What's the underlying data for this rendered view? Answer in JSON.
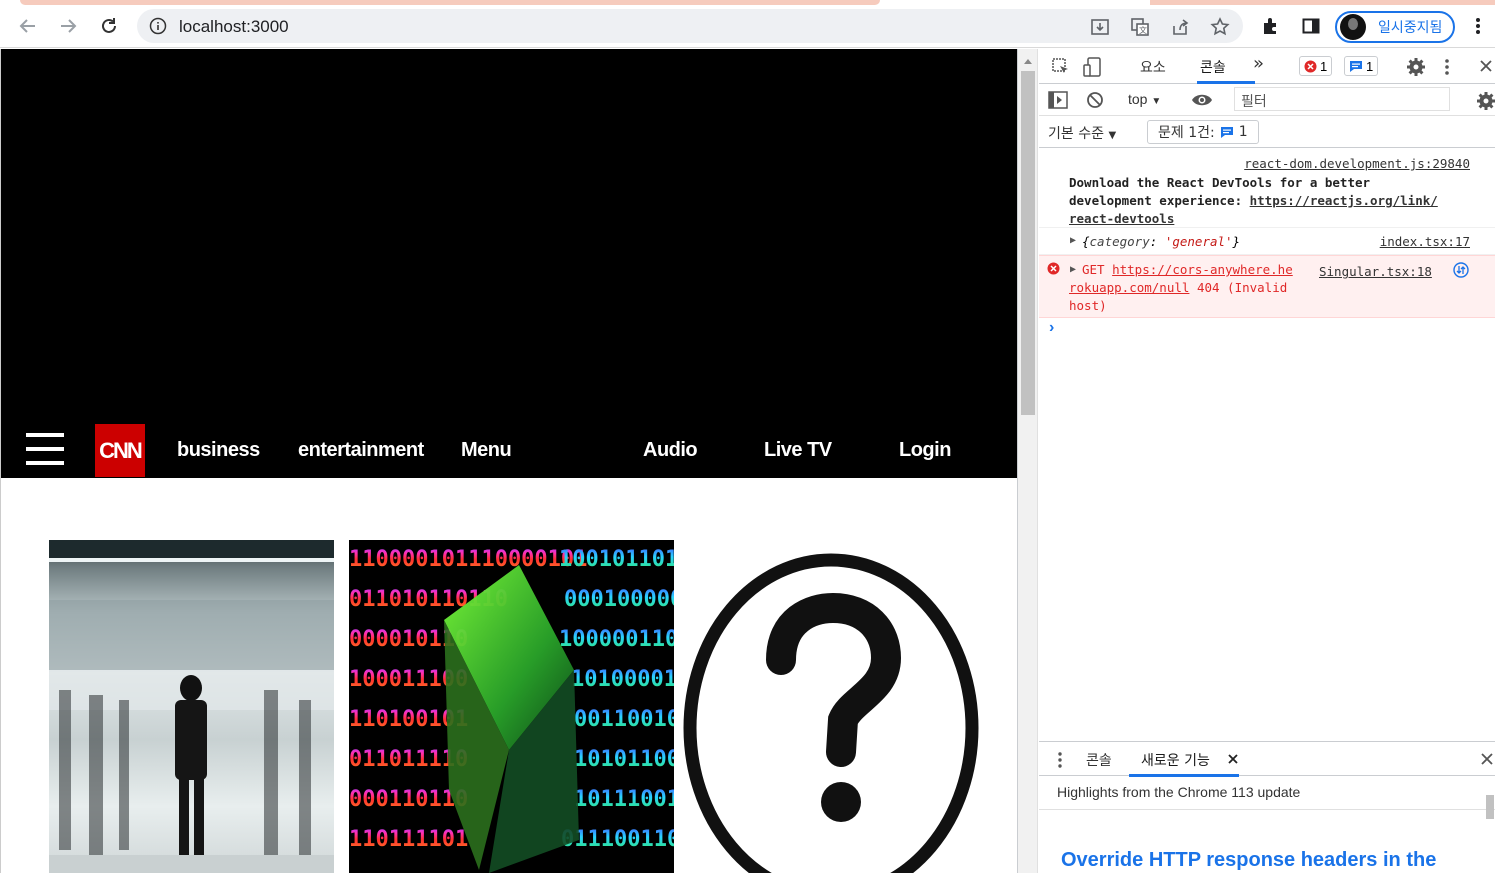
{
  "browser": {
    "url": "localhost:3000",
    "profile_label": "일시중지됨"
  },
  "site": {
    "logo_text": "CNN",
    "nav": [
      "business",
      "entertainment",
      "Menu",
      "Audio",
      "Live TV",
      "Login"
    ]
  },
  "devtools": {
    "tabs": [
      "요소",
      "콘솔"
    ],
    "more_tabs": "»",
    "error_count": "1",
    "message_count": "1",
    "context": "top",
    "filter_placeholder": "필터",
    "levels": "기본 수준",
    "issues_label": "문제 1건:",
    "issues_count": "1",
    "messages": [
      {
        "source": "react-dom.development.js:29840",
        "text_line1": "Download the React DevTools for a better",
        "text_line2_prefix": "development experience: ",
        "link_line2": "https://reactjs.org/link/",
        "link_line3": "react-devtools"
      },
      {
        "source": "index.tsx:17",
        "obj_open": "{",
        "obj_key": "category",
        "obj_sep": ": ",
        "obj_value": "'general'",
        "obj_close": "}"
      },
      {
        "source": "Singular.tsx:18",
        "method": "GET ",
        "url_line1": "https://cors-anywhere.he",
        "url_line2": "rokuapp.com/null",
        "status": " 404 (Invalid",
        "status_line3": "host)"
      }
    ],
    "prompt": "›",
    "drawer": {
      "tabs": [
        "콘솔",
        "새로운 기능"
      ],
      "highlights": "Highlights from the Chrome 113 update",
      "headline": "Override HTTP response headers in the"
    }
  },
  "colors": {
    "cnn_red": "#cc0000",
    "devtools_blue": "#1a73e8",
    "error_red": "#e02828"
  }
}
